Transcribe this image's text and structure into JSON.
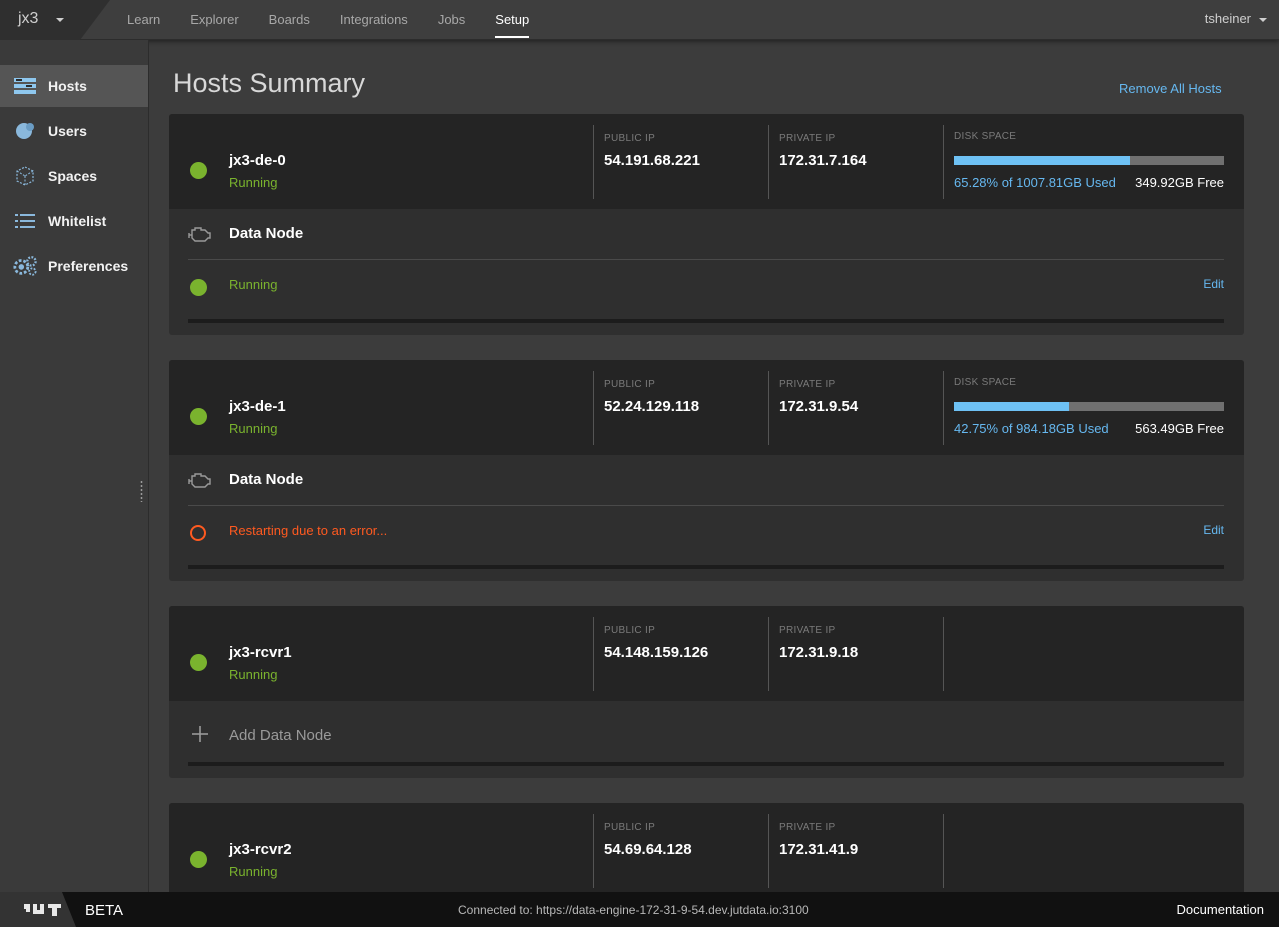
{
  "app": {
    "name": "jx3"
  },
  "nav": [
    "Learn",
    "Explorer",
    "Boards",
    "Integrations",
    "Jobs",
    "Setup"
  ],
  "nav_active": "Setup",
  "user": "tsheiner",
  "sidebar": [
    {
      "label": "Hosts",
      "icon": "hosts-icon",
      "active": true
    },
    {
      "label": "Users",
      "icon": "users-icon",
      "active": false
    },
    {
      "label": "Spaces",
      "icon": "spaces-icon",
      "active": false
    },
    {
      "label": "Whitelist",
      "icon": "list-icon",
      "active": false
    },
    {
      "label": "Preferences",
      "icon": "gears-icon",
      "active": false
    }
  ],
  "page": {
    "title": "Hosts Summary",
    "remove_all": "Remove All Hosts"
  },
  "labels": {
    "public_ip": "PUBLIC IP",
    "private_ip": "PRIVATE IP",
    "disk_space": "DISK SPACE",
    "data_node": "Data Node",
    "edit": "Edit",
    "add_data_node": "Add Data Node"
  },
  "hosts": [
    {
      "name": "jx3-de-0",
      "status": "Running",
      "public_ip": "54.191.68.221",
      "private_ip": "172.31.7.164",
      "disk": {
        "used_fraction": 0.6528,
        "used_text": "65.28% of 1007.81GB Used",
        "free_text": "349.92GB Free"
      },
      "node": {
        "status": "Running",
        "state": "ok"
      }
    },
    {
      "name": "jx3-de-1",
      "status": "Running",
      "public_ip": "52.24.129.118",
      "private_ip": "172.31.9.54",
      "disk": {
        "used_fraction": 0.4275,
        "used_text": "42.75% of 984.18GB Used",
        "free_text": "563.49GB Free"
      },
      "node": {
        "status": "Restarting due to an error...",
        "state": "error"
      }
    },
    {
      "name": "jx3-rcvr1",
      "status": "Running",
      "public_ip": "54.148.159.126",
      "private_ip": "172.31.9.18"
    },
    {
      "name": "jx3-rcvr2",
      "status": "Running",
      "public_ip": "54.69.64.128",
      "private_ip": "172.31.41.9"
    }
  ],
  "footer": {
    "beta": "BETA",
    "connection": "Connected to: https://data-engine-172-31-9-54.dev.jutdata.io:3100",
    "docs": "Documentation"
  },
  "colors": {
    "accent": "#66b8f0",
    "ok": "#7ab32e",
    "error": "#ff5a20",
    "disk_fill": "#6ec1f4"
  }
}
